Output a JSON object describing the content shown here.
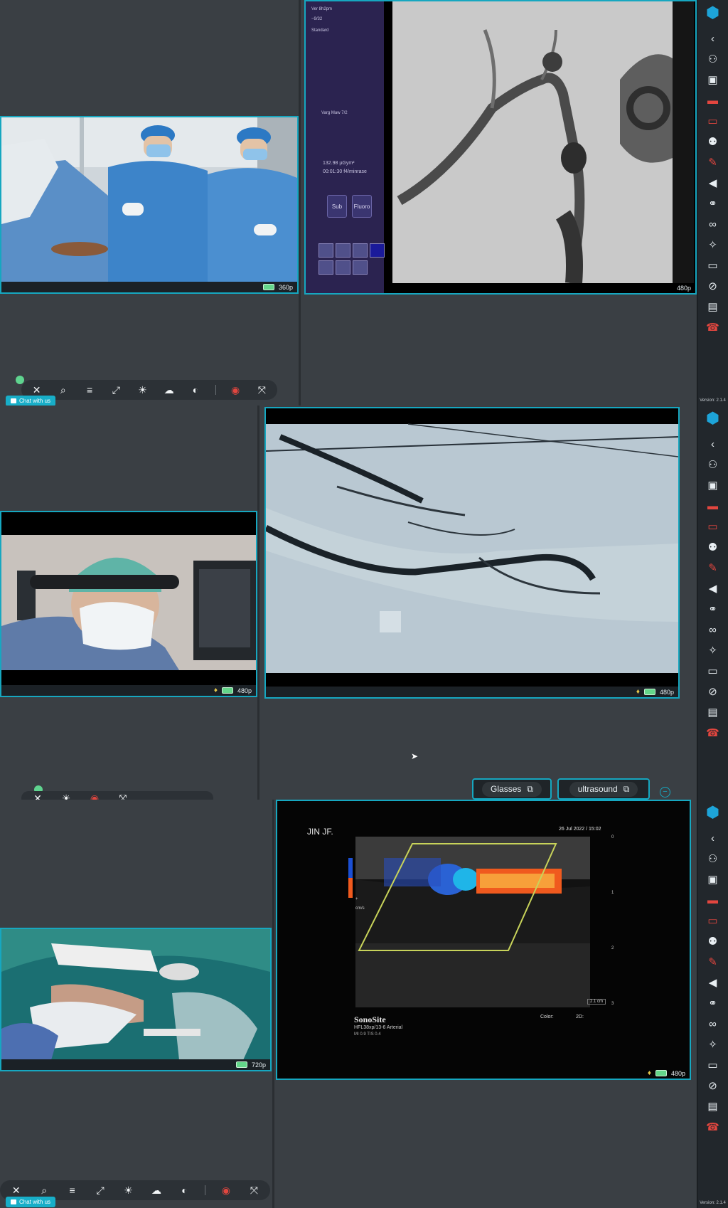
{
  "sessions": [
    {
      "camera": {
        "resolution": "360p"
      },
      "fluoro": {
        "info_line1": "Ver 8h2pm",
        "info_line2": "~9/32",
        "info_line3": "Standard",
        "info_line4": "Varg Maw    7/2",
        "dose": "132.98 µGym²",
        "time": "00:01:30 f4/minrase",
        "btn_sub": "Sub",
        "btn_fluoro": "Fluoro",
        "resolution": "480p"
      },
      "chat_label": "Chat with us"
    },
    {
      "camera": {
        "resolution": "480p"
      },
      "angio": {
        "resolution": "480p"
      },
      "sources": [
        {
          "label": "Glasses"
        },
        {
          "label": "ultrasound"
        }
      ]
    },
    {
      "camera": {
        "resolution": "720p"
      },
      "ultrasound": {
        "patient": "JIN JF.",
        "date": "26 Jul 2022 / 15:02",
        "brand": "SonoSite",
        "probe": "HFL38xp/13-6  Arterial",
        "params": "MI 0.9  TIS 0.4",
        "color_label": "Color:",
        "twod_label": "2D:",
        "depth_marks": [
          "0",
          "1",
          "2",
          "3"
        ],
        "depth_box": "2.1 cm",
        "scale_top": "+",
        "scale_bottom": "cm/s",
        "resolution": "480p"
      },
      "chat_label": "Chat with us"
    }
  ],
  "rail": {
    "version": "Version: 2.1.4",
    "icons": [
      "logo-icon",
      "chevron-left-icon",
      "glasses-icon",
      "panel-icon",
      "video-off-icon",
      "screen-share-icon",
      "add-user-icon",
      "mic-off-icon",
      "speaker-icon",
      "participants-icon",
      "handshake-icon",
      "laser-pointer-icon",
      "battery-icon",
      "no-record-icon",
      "trash-icon",
      "end-call-icon"
    ]
  },
  "toolbar": {
    "icons": [
      "close-icon",
      "zoom-icon",
      "stack-icon",
      "expand-icon",
      "brightness-icon",
      "contrast-icon",
      "invert-icon",
      "record-icon",
      "fullscreen-icon"
    ]
  }
}
